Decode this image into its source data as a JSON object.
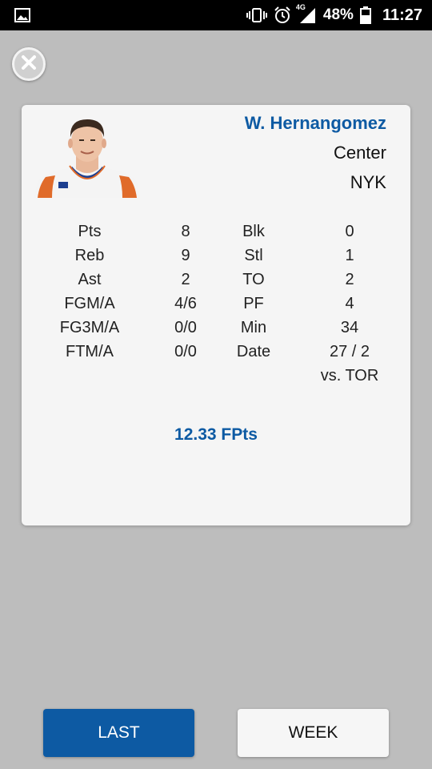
{
  "status_bar": {
    "network": "4G",
    "battery": "48%",
    "time": "11:27"
  },
  "player": {
    "name": "W. Hernangomez",
    "position": "Center",
    "team": "NYK"
  },
  "stats": [
    {
      "l1": "Pts",
      "v1": "8",
      "l2": "Blk",
      "v2": "0"
    },
    {
      "l1": "Reb",
      "v1": "9",
      "l2": "Stl",
      "v2": "1"
    },
    {
      "l1": "Ast",
      "v1": "2",
      "l2": "TO",
      "v2": "2"
    },
    {
      "l1": "FGM/A",
      "v1": "4/6",
      "l2": "PF",
      "v2": "4"
    },
    {
      "l1": "FG3M/A",
      "v1": "0/0",
      "l2": "Min",
      "v2": "34"
    },
    {
      "l1": "FTM/A",
      "v1": "0/0",
      "l2": "Date",
      "v2": "27 / 2"
    },
    {
      "l1": "",
      "v1": "",
      "l2": "",
      "v2": "vs. TOR"
    }
  ],
  "fpts": "12.33 FPts",
  "buttons": {
    "last": "LAST",
    "week": "WEEK"
  },
  "colors": {
    "accent": "#0d5aa3",
    "background": "#bdbdbd",
    "card": "#f5f5f5"
  }
}
